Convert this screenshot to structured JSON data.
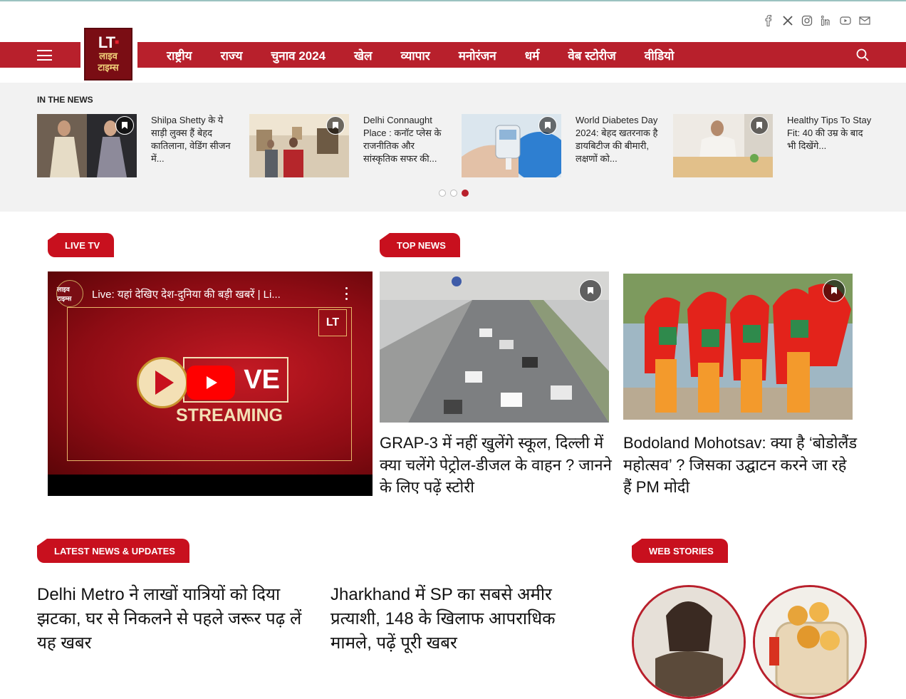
{
  "social": [
    "facebook-icon",
    "x-icon",
    "instagram-icon",
    "linkedin-icon",
    "youtube-icon",
    "mail-icon"
  ],
  "logo": {
    "mark": "LT",
    "line1": "लाइव",
    "line2": "टाइम्स"
  },
  "nav": {
    "items": [
      "राष्ट्रीय",
      "राज्य",
      "चुनाव 2024",
      "खेल",
      "व्यापार",
      "मनोरंजन",
      "धर्म",
      "वेब स्टोरीज",
      "वीडियो"
    ]
  },
  "in_the_news": {
    "heading": "IN THE NEWS",
    "cards": [
      {
        "title": "Shilpa Shetty के ये साड़ी लुक्स हैं बेहद कातिलाना, वेडिंग सीजन में..."
      },
      {
        "title": "Delhi Connaught Place : कनॉट प्लेस के राजनीतिक और सांस्कृतिक सफर की..."
      },
      {
        "title": "World Diabetes Day 2024: बेहद खतरनाक है डायबिटीज की बीमारी, लक्षणों को..."
      },
      {
        "title": "Healthy Tips To Stay Fit: 40 की उम्र के बाद भी दिखेंगे..."
      }
    ],
    "active_page": 3,
    "pages": 3
  },
  "sections": {
    "live_tv": "LIVE TV",
    "top_news": "TOP NEWS",
    "latest": "LATEST NEWS & UPDATES",
    "web_stories": "WEB STORIES"
  },
  "video": {
    "title": "Live: यहां देखिए देश-दुनिया की बड़ी खबरें | Li...",
    "channel_badge": "लाइव टाइम्स",
    "live_word": "VE",
    "streaming_word": "STREAMING",
    "brand_mark": "LT"
  },
  "top_news": [
    {
      "title": "GRAP-3 में नहीं खुलेंगे स्कूल, दिल्ली में क्या चलेंगे पेट्रोल-डीजल के वाहन ? जानने के लिए पढ़ें स्टोरी"
    },
    {
      "title": "Bodoland Mohotsav: क्या है ‘बोडोलैंड महोत्सव’ ? जिसका उद्घाटन करने जा रहे हैं PM मोदी"
    }
  ],
  "latest": [
    {
      "title": "Delhi Metro ने लाखों यात्रियों को दिया झटका, घर से निकलने से पहले जरूर पढ़ लें यह खबर"
    },
    {
      "title": "Jharkhand में SP का सबसे अमीर प्रत्याशी, 148 के खिलाफ आपराधिक मामले, पढ़ें पूरी खबर"
    }
  ],
  "colors": {
    "brand_red": "#b8202c",
    "tag_red": "#c8101e",
    "band_gray": "#f2f2f2"
  }
}
